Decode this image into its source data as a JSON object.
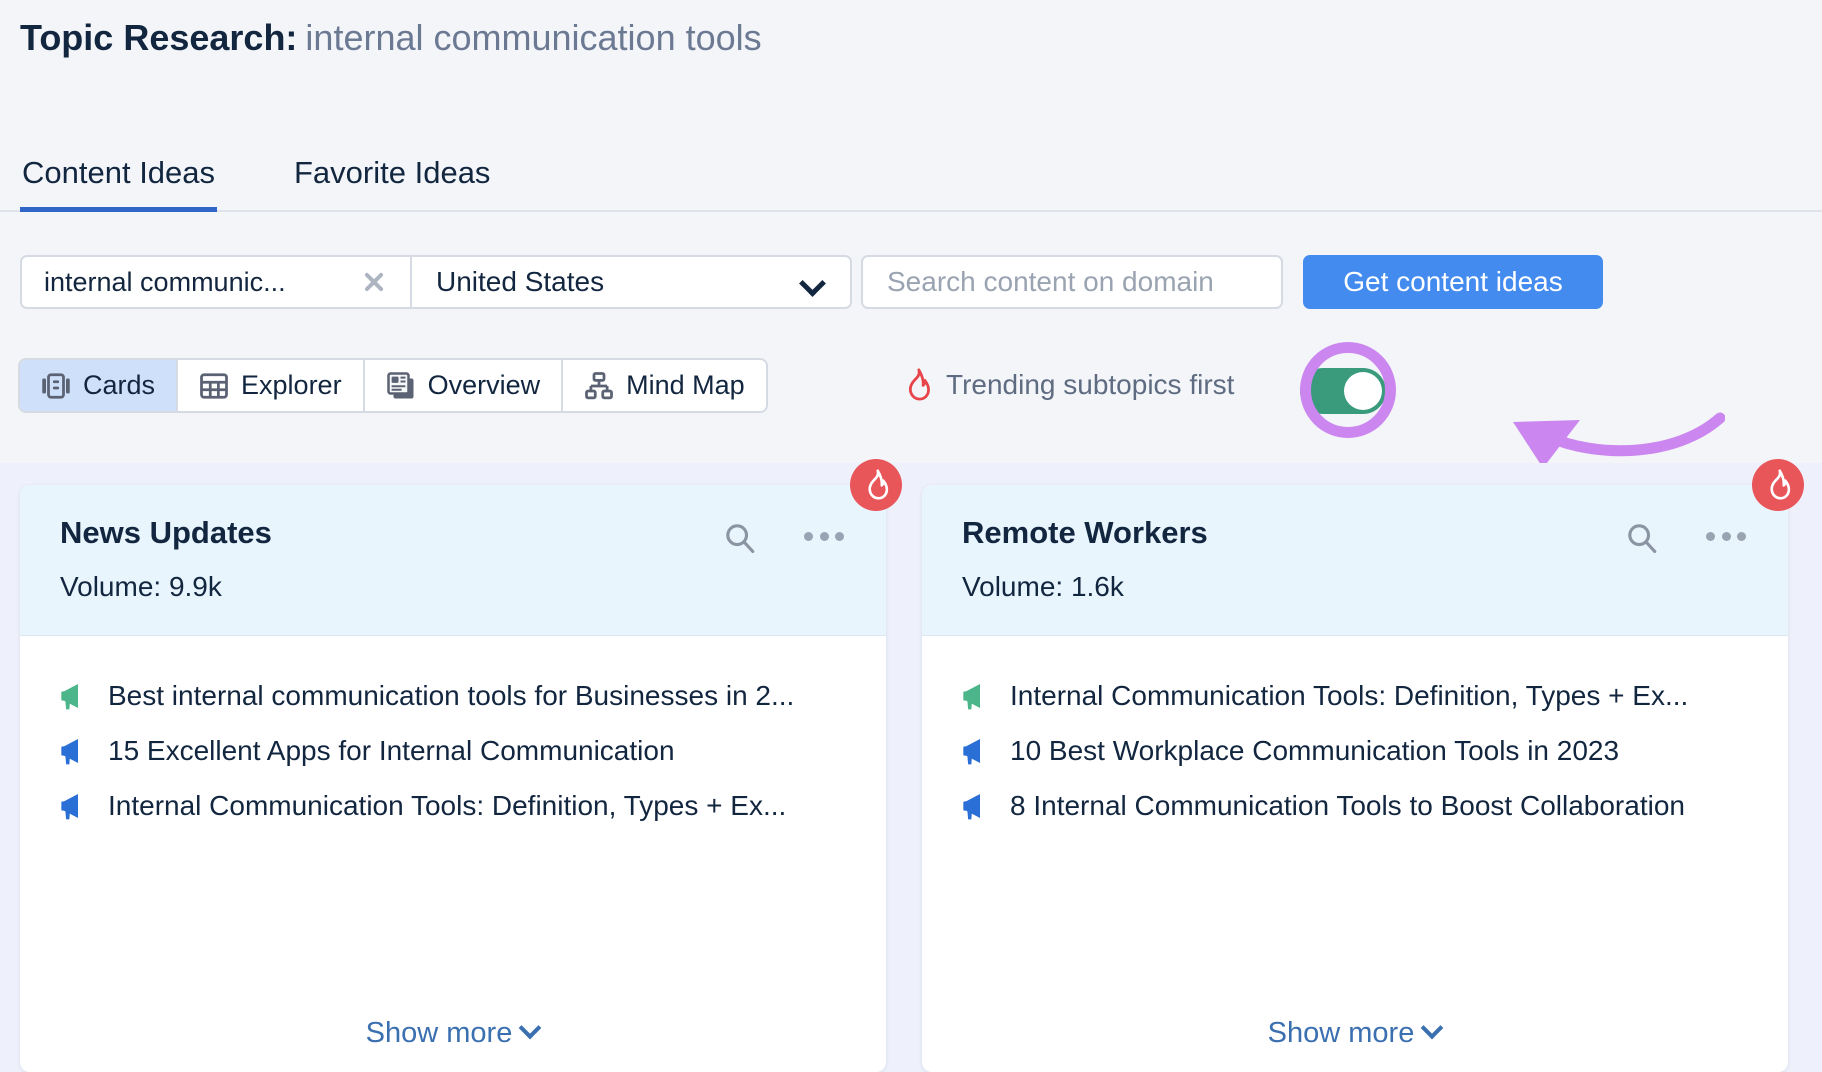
{
  "header": {
    "title_strong": "Topic Research:",
    "title_light": "internal communication tools"
  },
  "tabs": [
    {
      "label": "Content Ideas",
      "active": true
    },
    {
      "label": "Favorite Ideas",
      "active": false
    }
  ],
  "search": {
    "keyword_value": "internal communic...",
    "clear_icon": "close-icon",
    "country_value": "United States",
    "country_caret_icon": "chevron-down-icon",
    "domain_placeholder": "Search content on domain",
    "domain_value": "",
    "submit_label": "Get content ideas"
  },
  "view_modes": [
    {
      "label": "Cards",
      "icon": "cards-icon",
      "active": true
    },
    {
      "label": "Explorer",
      "icon": "table-icon",
      "active": false
    },
    {
      "label": "Overview",
      "icon": "newspaper-icon",
      "active": false
    },
    {
      "label": "Mind Map",
      "icon": "sitemap-icon",
      "active": false
    }
  ],
  "trending": {
    "icon": "fire-icon",
    "label": "Trending subtopics first",
    "toggle_state": "on",
    "toggle_color": "#3a9a7c",
    "annotation_color": "#cb87ef"
  },
  "cards": [
    {
      "title": "News Updates",
      "volume_label": "Volume: 9.9k",
      "badge_icon": "fire-icon",
      "search_icon": "search-icon",
      "menu_icon": "ellipsis-icon",
      "ideas": [
        {
          "text": "Best internal communication tools for Businesses in 2...",
          "icon": "megaphone-icon",
          "color": "#4cb58a"
        },
        {
          "text": "15 Excellent Apps for Internal Communication",
          "icon": "megaphone-icon",
          "color": "#2a6fd6"
        },
        {
          "text": "Internal Communication Tools: Definition, Types + Ex...",
          "icon": "megaphone-icon",
          "color": "#2a6fd6"
        }
      ],
      "show_more_label": "Show more"
    },
    {
      "title": "Remote Workers",
      "volume_label": "Volume: 1.6k",
      "badge_icon": "fire-icon",
      "search_icon": "search-icon",
      "menu_icon": "ellipsis-icon",
      "ideas": [
        {
          "text": "Internal Communication Tools: Definition, Types + Ex...",
          "icon": "megaphone-icon",
          "color": "#4cb58a"
        },
        {
          "text": "10 Best Workplace Communication Tools in 2023",
          "icon": "megaphone-icon",
          "color": "#2a6fd6"
        },
        {
          "text": "8 Internal Communication Tools to Boost Collaboration",
          "icon": "megaphone-icon",
          "color": "#2a6fd6"
        }
      ],
      "show_more_label": "Show more"
    }
  ],
  "colors": {
    "accent_blue": "#438bef",
    "tab_underline": "#2f66c8",
    "card_header_bg": "#e9f5fd",
    "page_bg": "#f3f5f9",
    "cards_area_bg": "#eef1fb",
    "badge_red": "#e8565a"
  }
}
